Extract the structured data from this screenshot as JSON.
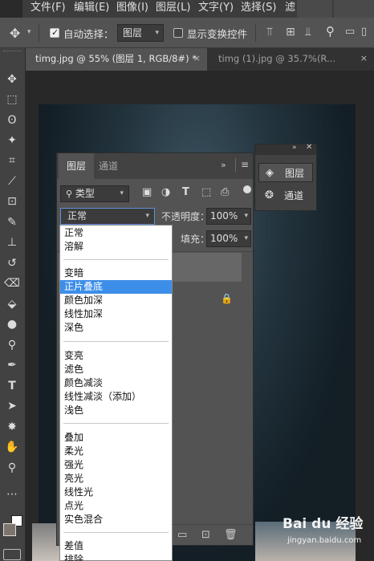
{
  "menu": {
    "items": [
      "文件(F)",
      "编辑(E)",
      "图像(I)",
      "图层(L)",
      "文字(Y)",
      "选择(S)",
      "滤"
    ]
  },
  "options": {
    "auto_select_label": "自动选择：",
    "auto_select_value": "图层",
    "show_transform_label": "显示变换控件"
  },
  "tabs": [
    {
      "label": "timg.jpg @ 55% (图层 1, RGB/8#) *",
      "close": "×"
    },
    {
      "label": "timg (1).jpg @ 35.7%(R...",
      "close": "×"
    }
  ],
  "layers_panel": {
    "tabs": [
      "图层",
      "通道"
    ],
    "filter_label": "类型",
    "blend_mode": "正常",
    "opacity_label": "不透明度：",
    "opacity_value": "100%",
    "fill_label": "填充：",
    "fill_value": "100%"
  },
  "blend_modes": [
    [
      "正常",
      "溶解"
    ],
    [
      "变暗",
      "正片叠底",
      "颜色加深",
      "线性加深",
      "深色"
    ],
    [
      "变亮",
      "滤色",
      "颜色减淡",
      "线性减淡（添加）",
      "浅色"
    ],
    [
      "叠加",
      "柔光",
      "强光",
      "亮光",
      "线性光",
      "点光",
      "实色混合"
    ],
    [
      "差值",
      "排除"
    ]
  ],
  "selected_blend": "正片叠底",
  "mini_panel": {
    "items": [
      "图层",
      "通道"
    ]
  },
  "watermark": {
    "brand": "Bai du 经验",
    "url": "jingyan.baidu.com"
  }
}
